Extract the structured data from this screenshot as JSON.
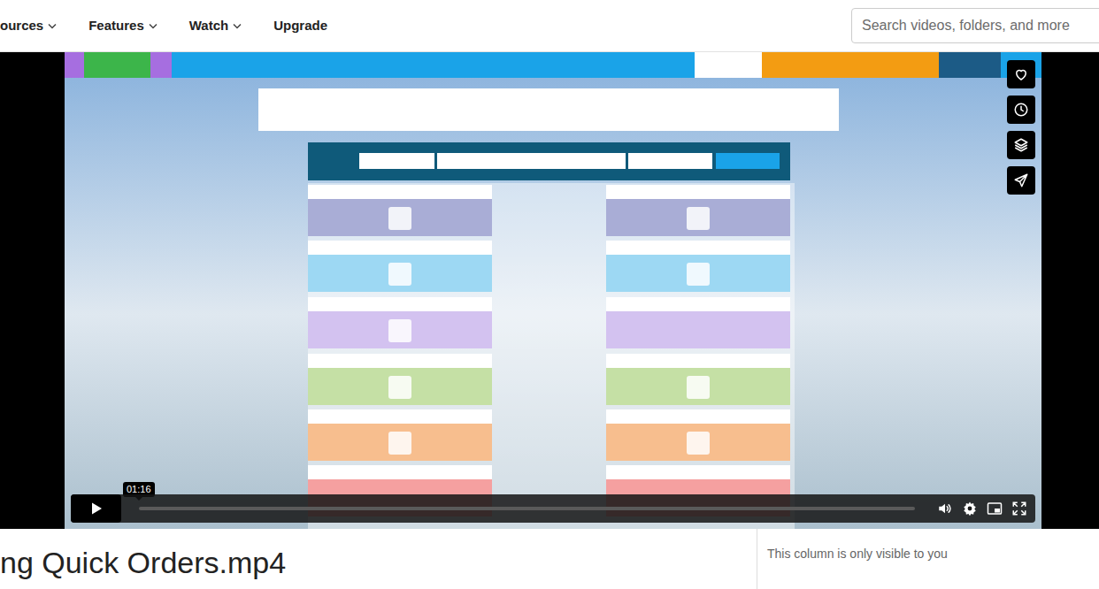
{
  "nav": {
    "items": [
      {
        "label": "ources",
        "kind": "menu"
      },
      {
        "label": "Features",
        "kind": "menu"
      },
      {
        "label": "Watch",
        "kind": "menu"
      },
      {
        "label": "Upgrade",
        "kind": "link"
      }
    ]
  },
  "search": {
    "placeholder": "Search videos, folders, and more"
  },
  "player": {
    "playing": false,
    "level": 0,
    "time_tooltip": "01:16"
  },
  "video": {
    "title": "ng Quick Orders.mp4"
  },
  "side_column": {
    "note": "This column is only visible to you"
  }
}
